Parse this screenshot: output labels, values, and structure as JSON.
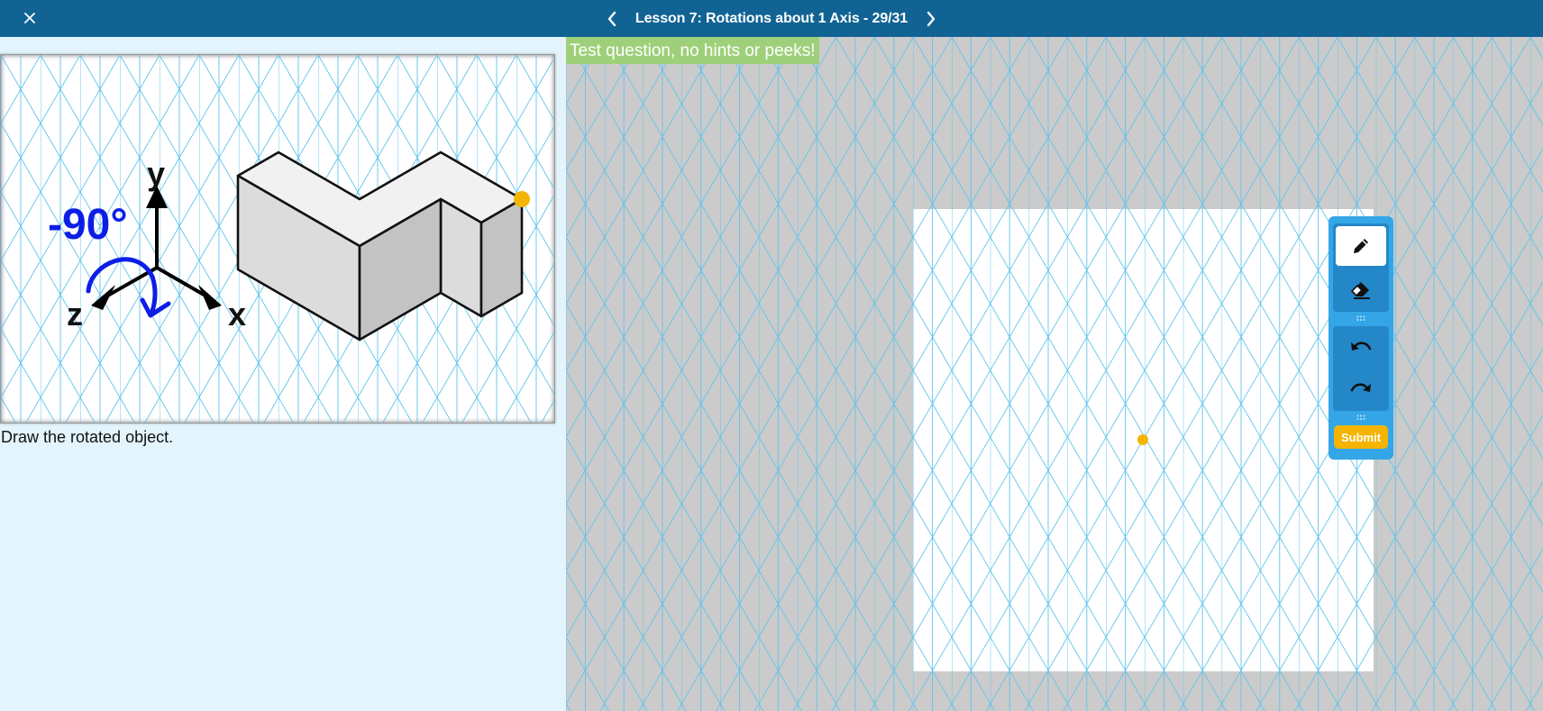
{
  "header": {
    "close_icon": "close-icon",
    "title": "Lesson 7: Rotations about 1 Axis - 29/31",
    "prev_icon": "chevron-left-icon",
    "next_icon": "chevron-right-icon"
  },
  "question": {
    "instruction": "Draw the rotated object.",
    "rotation_label": "-90°",
    "axis_labels": {
      "x": "x",
      "y": "y",
      "z": "z"
    }
  },
  "workspace": {
    "banner": "Test question, no hints or peeks!"
  },
  "toolbar": {
    "tools": [
      {
        "name": "pencil-icon",
        "active": true
      },
      {
        "name": "eraser-icon",
        "active": false
      },
      {
        "name": "undo-icon",
        "active": false
      },
      {
        "name": "redo-icon",
        "active": false
      }
    ],
    "submit_label": "Submit"
  },
  "colors": {
    "header_bg": "#116394",
    "left_bg": "#e3f4fd",
    "workspace_bg": "#cbcbcb",
    "grid_line": "#5ec3eb",
    "banner_bg": "#9ed07a",
    "toolbar_bg": "#34a6e8",
    "submit_bg": "#f5b400",
    "marker": "#f5b400",
    "rotation_arrow": "#0c1ee6"
  }
}
